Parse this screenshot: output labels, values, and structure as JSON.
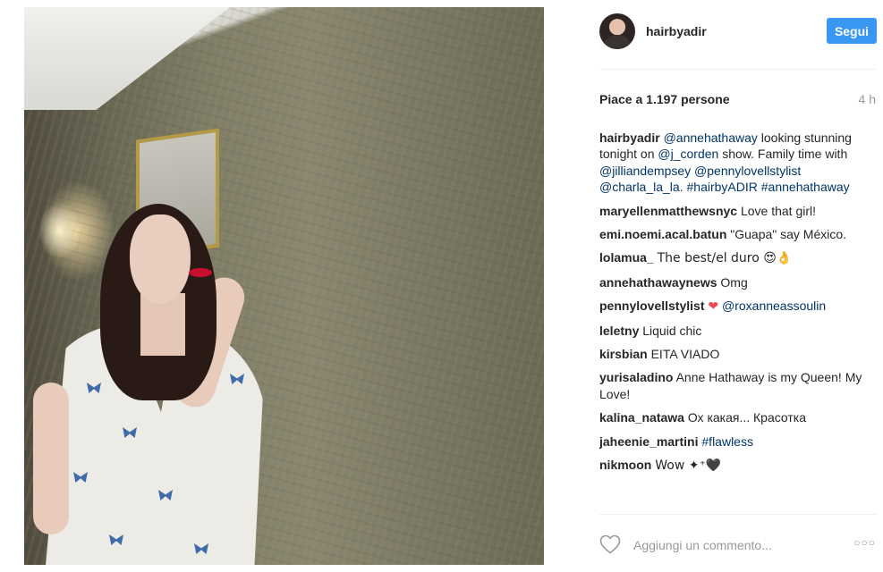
{
  "post": {
    "username": "hairbyadir",
    "follow_label": "Segui",
    "likes_text": "Piace a 1.197 persone",
    "time_ago": "4 h",
    "caption": {
      "user": "hairbyadir",
      "m1": "@annehathaway",
      "t1": " looking stunning tonight on ",
      "m2": "@j_corden",
      "t2": " show. Family time with ",
      "m3": "@jilliandempsey",
      "t3": " ",
      "m4": "@pennylovellstylist",
      "t4": " ",
      "m5": "@charla_la_la",
      "t5": ". ",
      "m6": "#hairbyADIR",
      "t6": " ",
      "m7": "#annehathaway"
    },
    "comments": [
      {
        "user": "maryellenmatthewsnyc",
        "text": "Love that girl!"
      },
      {
        "user": "emi.noemi.acal.batun",
        "text": "\"Guapa\" say México."
      },
      {
        "user": "lolamua_",
        "text": "The best/el duro 😍👌"
      },
      {
        "user": "annehathawaynews",
        "text": "Omg"
      },
      {
        "user": "pennylovellstylist",
        "heart": "❤",
        "mention": "@roxanneassoulin"
      },
      {
        "user": "leletny",
        "text": "Liquid chic"
      },
      {
        "user": "kirsbian",
        "text": "EITA VIADO"
      },
      {
        "user": "yurisaladino",
        "text": "Anne Hathaway is my Queen! My Love!"
      },
      {
        "user": "kalina_natawa",
        "text": "Ох какая... Красотка"
      },
      {
        "user": "jaheenie_martini",
        "mention": "#flawless"
      },
      {
        "user": "nikmoon",
        "text": "Wow ✦⁺🖤"
      }
    ],
    "comment_placeholder": "Aggiungi un commento...",
    "more_label": "○○○"
  },
  "icons": {
    "like": "heart-outline-icon",
    "more": "more-options-icon"
  },
  "colors": {
    "follow_button": "#3897f0",
    "mention": "#003569",
    "heart": "#ed4956"
  }
}
